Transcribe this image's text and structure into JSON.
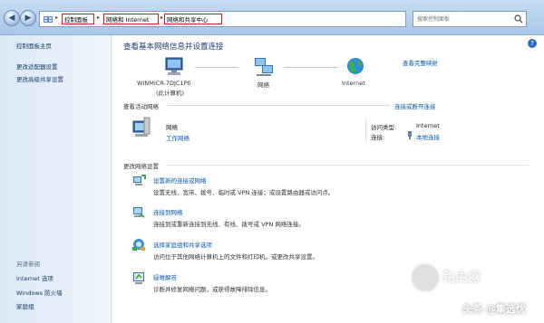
{
  "breadcrumb": {
    "items": [
      "控制面板",
      "网络和 Internet",
      "网络和共享中心"
    ],
    "separator": "▸"
  },
  "search": {
    "placeholder": "搜索控制面板"
  },
  "sidebar": {
    "home": "控制面板主页",
    "links": [
      "更改适配器设置",
      "更改高级共享设置"
    ],
    "see_also": "另请参阅",
    "see_also_links": [
      "Internet 选项",
      "Windows 防火墙",
      "家庭组"
    ]
  },
  "main": {
    "title": "查看基本网络信息并设置连接",
    "full_map": "查看完整映射",
    "map": {
      "computer": "WINMICR-7DJC1P0",
      "computer_sub": "(此计算机)",
      "network": "网络",
      "internet": "Internet"
    },
    "active": {
      "heading": "查看活动网络",
      "connect_link": "连接或断开连接",
      "network_name": "网络",
      "network_type": "工作网络",
      "access_label": "访问类型:",
      "access_value": "Internet",
      "conn_label": "连接:",
      "conn_value": "本地连接"
    },
    "change": {
      "heading": "更改网络设置",
      "tasks": [
        {
          "title": "设置新的连接或网络",
          "desc": "设置无线、宽带、拨号、临时或 VPN 连接；或设置路由器或访问点。"
        },
        {
          "title": "连接到网络",
          "desc": "连接到或重新连接到无线、有线、拨号或 VPN 网络连接。"
        },
        {
          "title": "选择家庭组和共享选项",
          "desc": "访问位于其他网络计算机上的文件和打印机，或更改共享设置。"
        },
        {
          "title": "疑难解答",
          "desc": "诊断并修复网络问题，或获得故障排除信息。"
        }
      ]
    }
  },
  "watermark": {
    "logo_text": "路由器",
    "author": "头条 @集选优"
  },
  "colors": {
    "highlight_box": "#e0171e",
    "link": "#0b56b8",
    "heading": "#1d3d77"
  }
}
